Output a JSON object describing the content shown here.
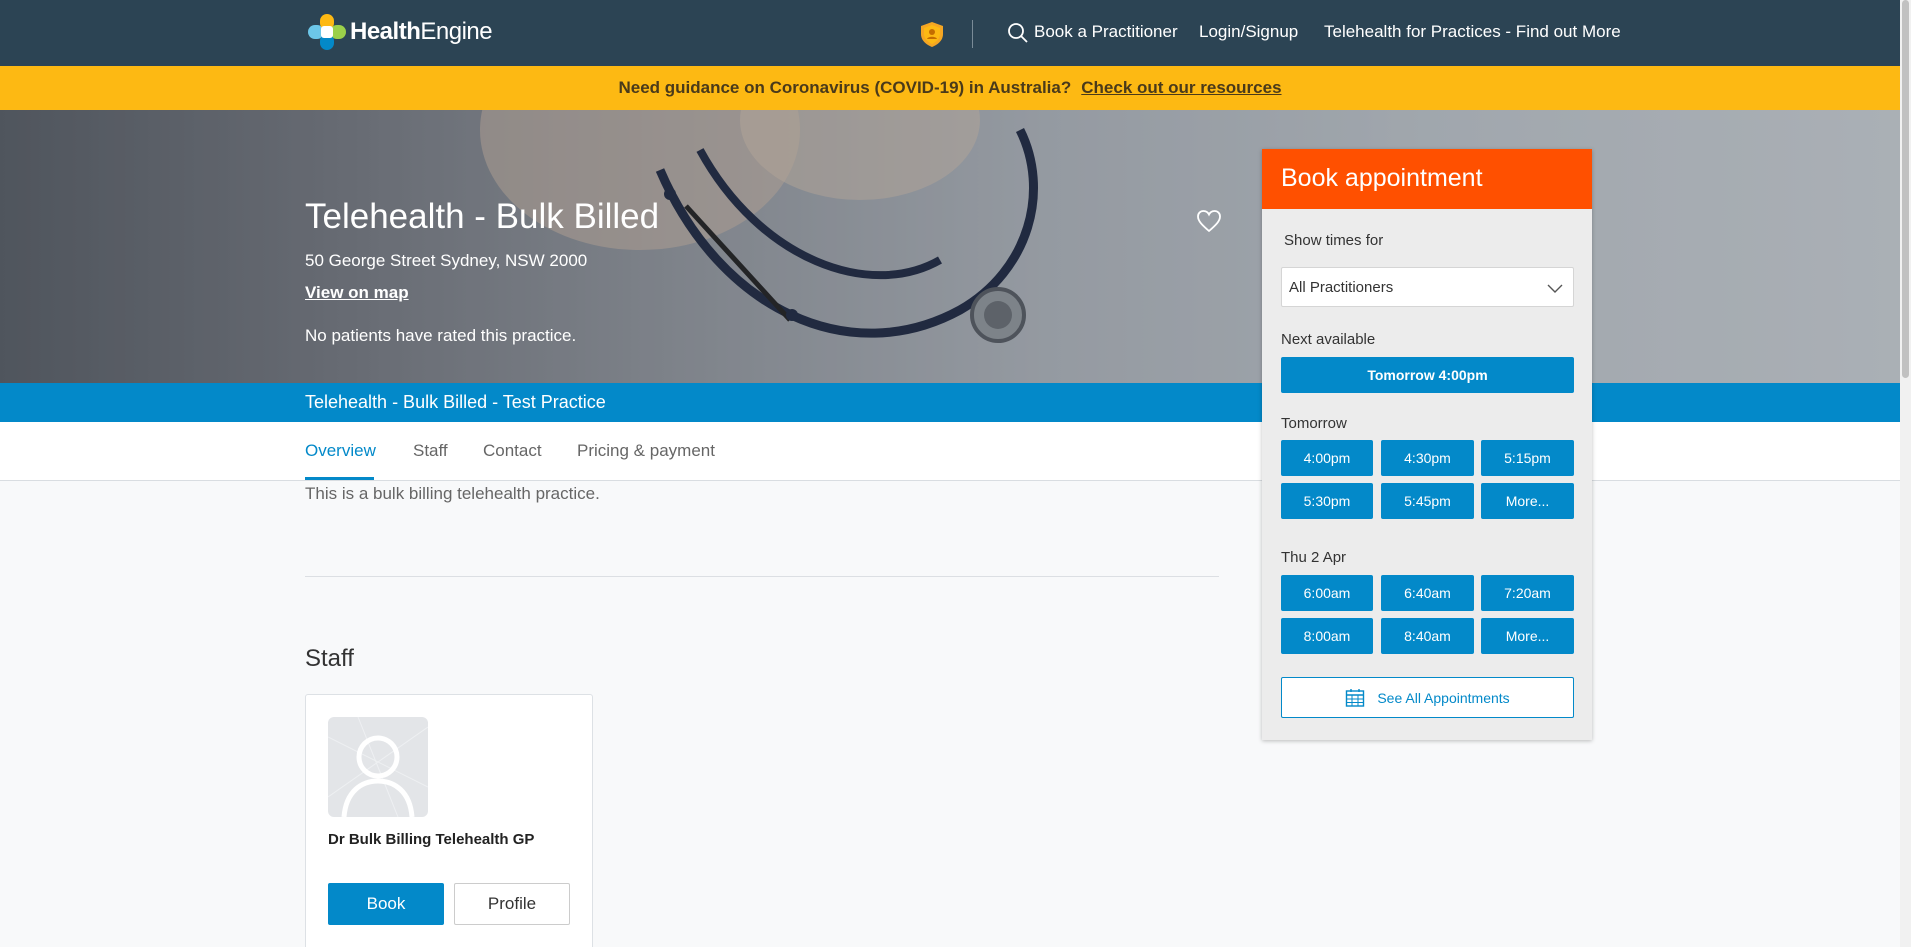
{
  "nav": {
    "logo_bold": "Health",
    "logo_rest": "Engine",
    "book_link": "Book a Practitioner",
    "login_link": "Login/Signup",
    "telehealth_link": "Telehealth for Practices - Find out More"
  },
  "banner": {
    "text": "Need guidance on Coronavirus (COVID-19) in Australia?",
    "link": "Check out our resources"
  },
  "hero": {
    "title": "Telehealth - Bulk Billed",
    "address": "50 George Street Sydney, NSW 2000",
    "map_link": "View on map",
    "rating": "No patients have rated this practice."
  },
  "strip": {
    "text": "Telehealth - Bulk Billed - Test Practice"
  },
  "tabs": [
    "Overview",
    "Staff",
    "Contact",
    "Pricing & payment"
  ],
  "overview": {
    "description": "This is a bulk billing telehealth practice."
  },
  "staff": {
    "heading": "Staff",
    "name": "Dr Bulk Billing Telehealth GP",
    "book_label": "Book",
    "profile_label": "Profile"
  },
  "booking": {
    "header": "Book appointment",
    "show_times_label": "Show times for",
    "practitioner_select": "All Practitioners",
    "next_available_label": "Next available",
    "next_available": "Tomorrow 4:00pm",
    "days": [
      {
        "label": "Tomorrow",
        "slots": [
          "4:00pm",
          "4:30pm",
          "5:15pm",
          "5:30pm",
          "5:45pm",
          "More..."
        ]
      },
      {
        "label": "Thu 2 Apr",
        "slots": [
          "6:00am",
          "6:40am",
          "7:20am",
          "8:00am",
          "8:40am",
          "More..."
        ]
      }
    ],
    "see_all": "See All Appointments"
  },
  "colors": {
    "nav_bg": "#2c4454",
    "banner_bg": "#fdb913",
    "primary_blue": "#0389c9",
    "book_header": "#ff5000"
  }
}
